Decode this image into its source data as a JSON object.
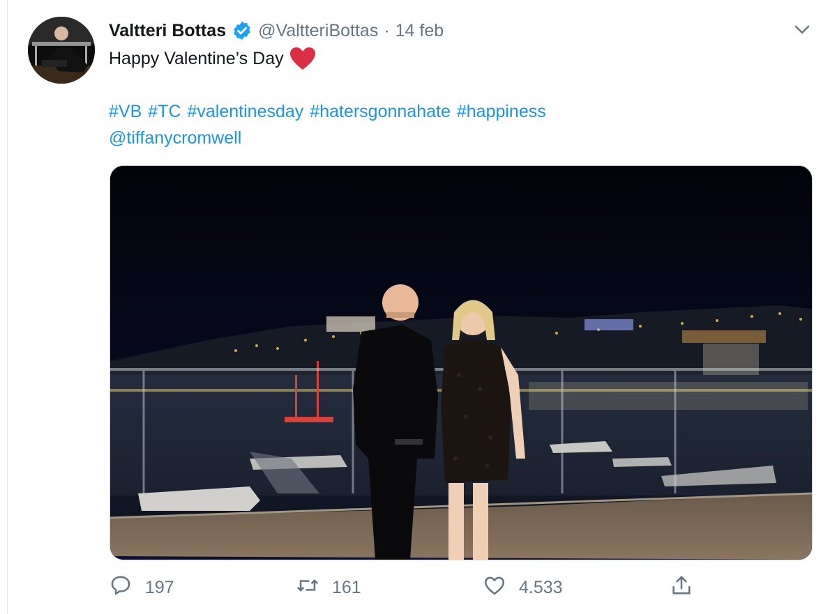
{
  "tweet": {
    "display_name": "Valtteri Bottas",
    "handle": "@ValtteriBottas",
    "separator": "·",
    "date": "14 feb",
    "text": "Happy Valentine’s Day",
    "hashtags": [
      "#VB",
      "#TC",
      "#valentinesday",
      "#hatersgonnahate",
      "#happiness"
    ],
    "mention": "@tiffanycromwell"
  },
  "actions": {
    "replies": "197",
    "retweets": "161",
    "likes": "4.533"
  },
  "colors": {
    "link": "#1b95e0",
    "verified": "#1da1f2",
    "heart": "#e0245e",
    "secondary_text": "#657786"
  },
  "icons": {
    "verified": "verified-badge-icon",
    "caret": "chevron-down-icon",
    "emoji": "red-heart-emoji",
    "reply": "speech-bubble-icon",
    "retweet": "retweet-arrows-icon",
    "like": "heart-outline-icon",
    "share": "share-upload-icon"
  }
}
